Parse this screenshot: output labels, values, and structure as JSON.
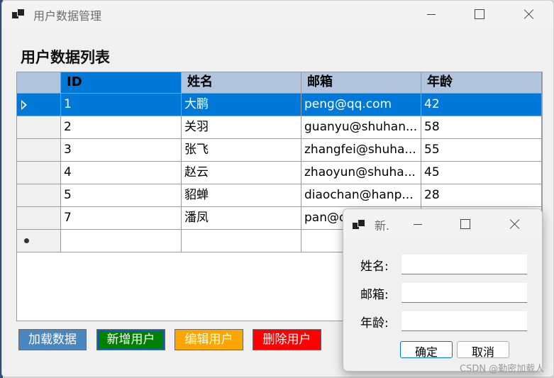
{
  "window": {
    "title": "用户数据管理"
  },
  "page": {
    "list_title": "用户数据列表"
  },
  "grid": {
    "columns": [
      "ID",
      "姓名",
      "邮箱",
      "年龄"
    ],
    "rows": [
      {
        "id": "1",
        "name": "大鹏",
        "email": "peng@qq.com",
        "age": "42"
      },
      {
        "id": "2",
        "name": "关羽",
        "email": "guanyu@shuhan...",
        "age": "58"
      },
      {
        "id": "3",
        "name": "张飞",
        "email": "zhangfei@shuha...",
        "age": "55"
      },
      {
        "id": "4",
        "name": "赵云",
        "email": "zhaoyun@shuha...",
        "age": "45"
      },
      {
        "id": "5",
        "name": "貂蝉",
        "email": "diaochan@hanp...",
        "age": "28"
      },
      {
        "id": "7",
        "name": "潘凤",
        "email": "pan@q",
        "age": ""
      }
    ],
    "selected_row_index": 0
  },
  "buttons": {
    "load": "加载数据",
    "add": "新增用户",
    "edit": "编辑用户",
    "delete": "删除用户"
  },
  "colors": {
    "header_bg": "#b0c4de",
    "selection": "#0078d7",
    "load_btn": "#4a86c0",
    "add_btn": "#008000",
    "edit_btn": "#ffa500",
    "delete_btn": "#ff0000"
  },
  "dialog": {
    "title": "新.",
    "name_label": "姓名:",
    "email_label": "邮箱:",
    "age_label": "年龄:",
    "name_value": "",
    "email_value": "",
    "age_value": "",
    "ok": "确定",
    "cancel": "取消"
  },
  "watermark": "CSDN @勤密加载人"
}
